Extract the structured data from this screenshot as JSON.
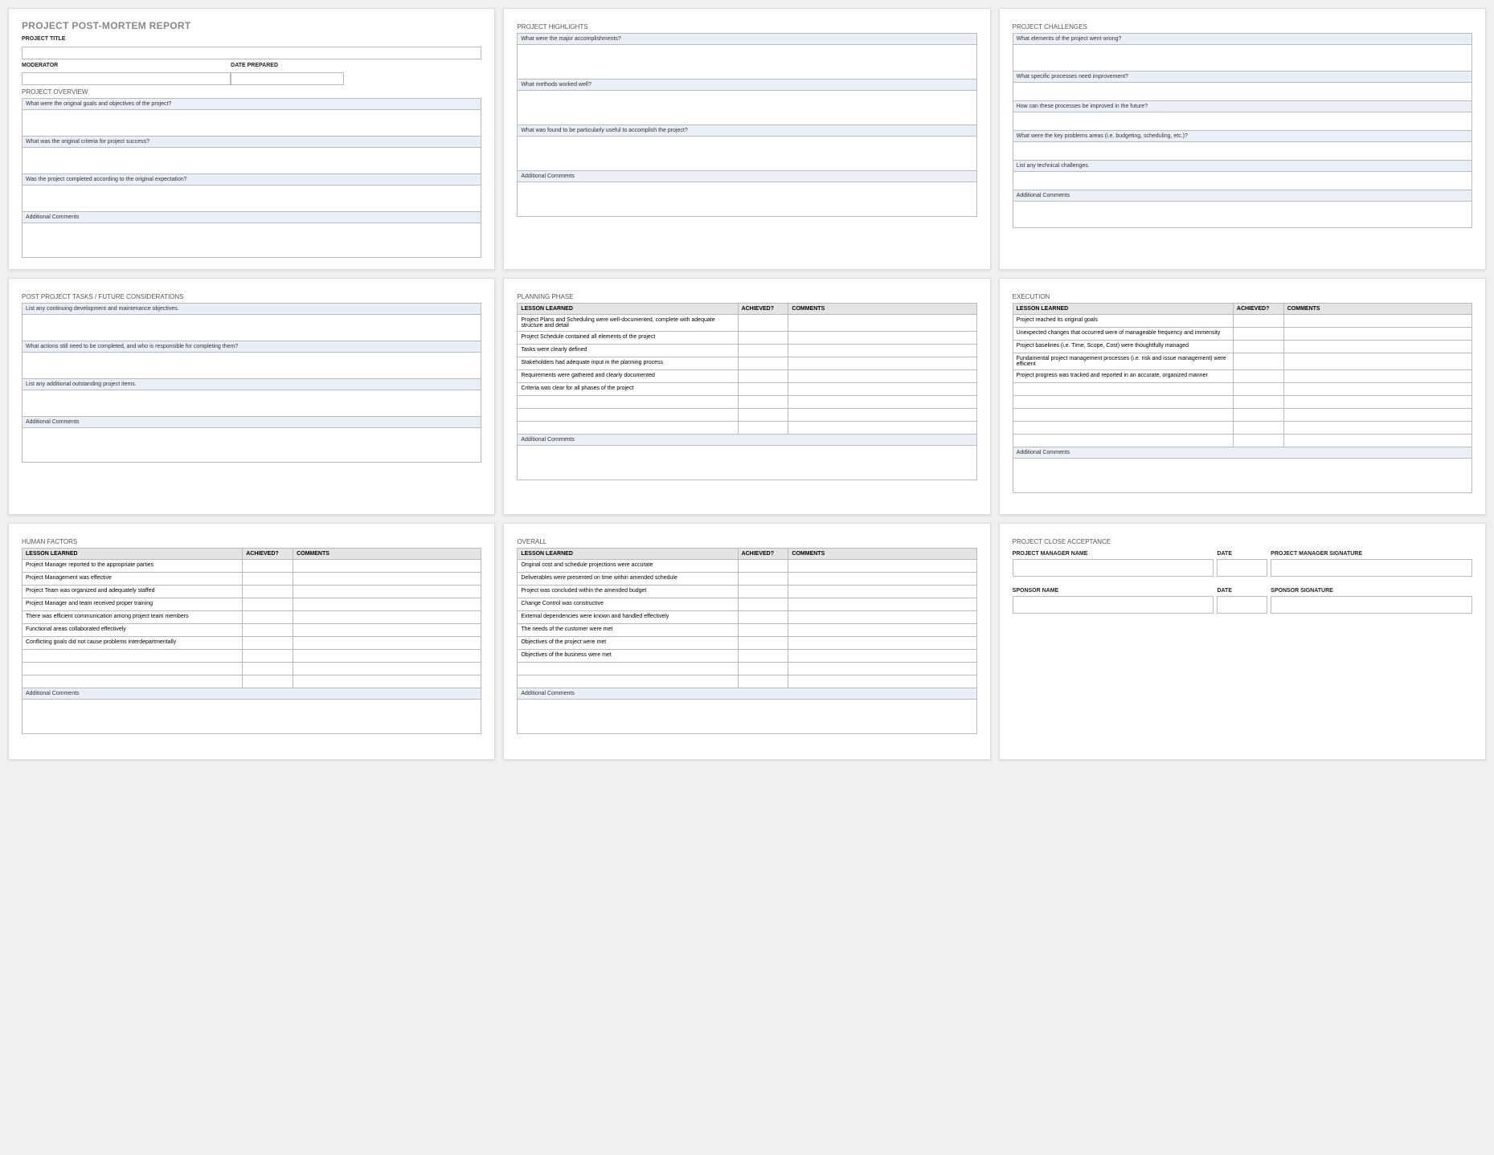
{
  "report": {
    "title": "PROJECT POST-MORTEM REPORT",
    "project_title_label": "PROJECT TITLE",
    "moderator_label": "MODERATOR",
    "date_prepared_label": "DATE PREPARED"
  },
  "overview": {
    "title": "PROJECT OVERVIEW",
    "q1": "What were the original goals and objectives of the project?",
    "q2": "What was the original criteria for project success?",
    "q3": "Was the project completed according to the original expectation?",
    "comments": "Additional Comments"
  },
  "highlights": {
    "title": "PROJECT HIGHLIGHTS",
    "q1": "What were the major accomplishments?",
    "q2": "What methods worked well?",
    "q3": "What was found to be particularly useful to accomplish the project?",
    "comments": "Additional Comments"
  },
  "challenges": {
    "title": "PROJECT CHALLENGES",
    "q1": "What elements of the project went wrong?",
    "q2": "What specific processes need improvement?",
    "q3": "How can these processes be improved in the future?",
    "q4": "What were the key problems areas (i.e. budgeting, scheduling, etc.)?",
    "q5": "List any technical challenges.",
    "comments": "Additional Comments"
  },
  "postproject": {
    "title": "POST PROJECT TASKS / FUTURE CONSIDERATIONS",
    "q1": "List any continuing development and maintenance objectives.",
    "q2": "What actions still need to be completed, and who is responsible for completing them?",
    "q3": "List any additional outstanding project items.",
    "comments": "Additional Comments"
  },
  "tables": {
    "th_lesson": "LESSON LEARNED",
    "th_achieved": "ACHIEVED?",
    "th_comments": "COMMENTS",
    "comments": "Additional Comments"
  },
  "planning": {
    "title": "PLANNING PHASE",
    "rows": [
      "Project Plans and Scheduling were well-documented, complete with adequate structure and detail",
      "Project Schedule contained all elements of the project",
      "Tasks were clearly defined",
      "Stakeholders had adequate input in the planning process",
      "Requirements were gathered and clearly documented",
      "Criteria was clear for all phases of the project",
      "",
      "",
      ""
    ]
  },
  "execution": {
    "title": "EXECUTION",
    "rows": [
      "Project reached its original goals",
      "Unexpected changes that occurred were of manageable frequency and immensity",
      "Project baselines (i.e. Time, Scope, Cost) were thoughtfully managed",
      "Fundamental project management processes (i.e. risk and issue management) were efficient",
      "Project progress was tracked and reported in an accurate, organized manner",
      "",
      "",
      "",
      "",
      ""
    ]
  },
  "human": {
    "title": "HUMAN FACTORS",
    "rows": [
      "Project Manager reported to the appropriate parties",
      "Project Management was effective",
      "Project Team was organized and adequately staffed",
      "Project Manager and team received proper training",
      "There was efficient communication among project team members",
      "Functional areas collaborated effectively",
      "Conflicting goals did not cause problems interdepartmentally",
      "",
      "",
      ""
    ]
  },
  "overall": {
    "title": "OVERALL",
    "rows": [
      "Original cost and schedule projections were accurate",
      "Deliverables were presented on time within amended schedule",
      "Project was concluded within the amended budget",
      "Change Control was constructive",
      "External dependencies were known and handled effectively",
      "The needs of the customer were met",
      "Objectives of the project were met",
      "Objectives of the business were met",
      "",
      ""
    ]
  },
  "close": {
    "title": "PROJECT CLOSE ACCEPTANCE",
    "pm_name": "PROJECT MANAGER NAME",
    "date": "DATE",
    "pm_sig": "PROJECT MANAGER SIGNATURE",
    "sponsor_name": "SPONSOR NAME",
    "sponsor_sig": "SPONSOR SIGNATURE"
  }
}
